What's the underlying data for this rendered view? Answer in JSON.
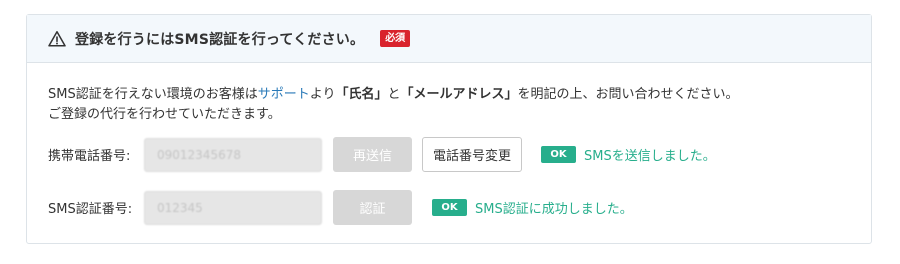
{
  "header": {
    "title": "登録を行うにはSMS認証を行ってください。",
    "required_badge": "必須",
    "icon": "warning-icon"
  },
  "notice": {
    "part1": "SMS認証を行えない環境のお客様は",
    "support_link": "サポート",
    "part2": "より",
    "name_field": "「氏名」",
    "part3": "と",
    "email_field": "「メールアドレス」",
    "part4": "を明記の上、お問い合わせください。",
    "line2": "ご登録の代行を行わせていただきます。"
  },
  "phone_row": {
    "label": "携帯電話番号:",
    "value": "09012345678",
    "resend_button": "再送信",
    "change_button": "電話番号変更",
    "ok_badge": "OK",
    "status": "SMSを送信しました。"
  },
  "code_row": {
    "label": "SMS認証番号:",
    "value": "012345",
    "verify_button": "認証",
    "ok_badge": "OK",
    "status": "SMS認証に成功しました。"
  },
  "colors": {
    "header_bg": "#f3f8fc",
    "required_badge": "#d9232d",
    "ok_green": "#27ae8c",
    "link_blue": "#2a7ab8",
    "disabled_button": "#d7d7d7"
  }
}
